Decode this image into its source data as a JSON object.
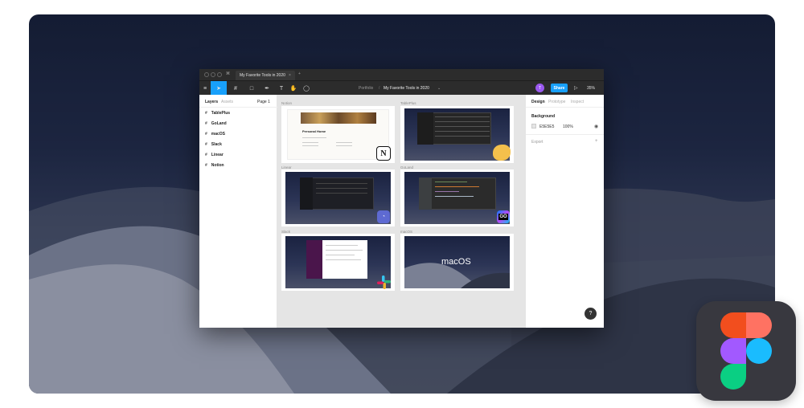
{
  "window": {
    "tab_title": "My Favorite Tools in 2020",
    "tab_close": "×",
    "tab_add": "+"
  },
  "toolbar": {
    "breadcrumb_parent": "Portfolio",
    "breadcrumb_sep": "/",
    "file_name": "My Favorite Tools in 2020",
    "share_label": "Share",
    "avatar_initial": "T",
    "zoom": "35%"
  },
  "left_panel": {
    "tab_layers": "Layers",
    "tab_assets": "Assets",
    "page": "Page 1",
    "layers": [
      "TablePlus",
      "GoLand",
      "macOS",
      "Slack",
      "Linear",
      "Notion"
    ]
  },
  "canvas": {
    "frames": [
      {
        "label": "Notion",
        "app": "notion"
      },
      {
        "label": "TablePlus",
        "app": "tableplus"
      },
      {
        "label": "Linear",
        "app": "linear"
      },
      {
        "label": "GoLand",
        "app": "goland"
      },
      {
        "label": "Slack",
        "app": "slack"
      },
      {
        "label": "macOS",
        "app": "macos"
      }
    ],
    "notion_page_title": "Personal Home",
    "macos_text": "macOS",
    "goland_badge": "GO"
  },
  "right_panel": {
    "tab_design": "Design",
    "tab_prototype": "Prototype",
    "tab_inspect": "Inspect",
    "background_heading": "Background",
    "bg_hex": "E5E5E5",
    "bg_opacity": "100%",
    "export_heading": "Export",
    "export_add": "+"
  },
  "help_label": "?",
  "colors": {
    "accent": "#18a0fb",
    "canvas_bg": "#e5e5e5",
    "toolbar_bg": "#2c2c2c"
  },
  "icons": [
    "menu-icon",
    "move-tool-icon",
    "frame-tool-icon",
    "shape-tool-icon",
    "pen-tool-icon",
    "text-tool-icon",
    "hand-tool-icon",
    "comment-tool-icon",
    "play-icon",
    "eye-icon",
    "figma-logo-icon"
  ]
}
